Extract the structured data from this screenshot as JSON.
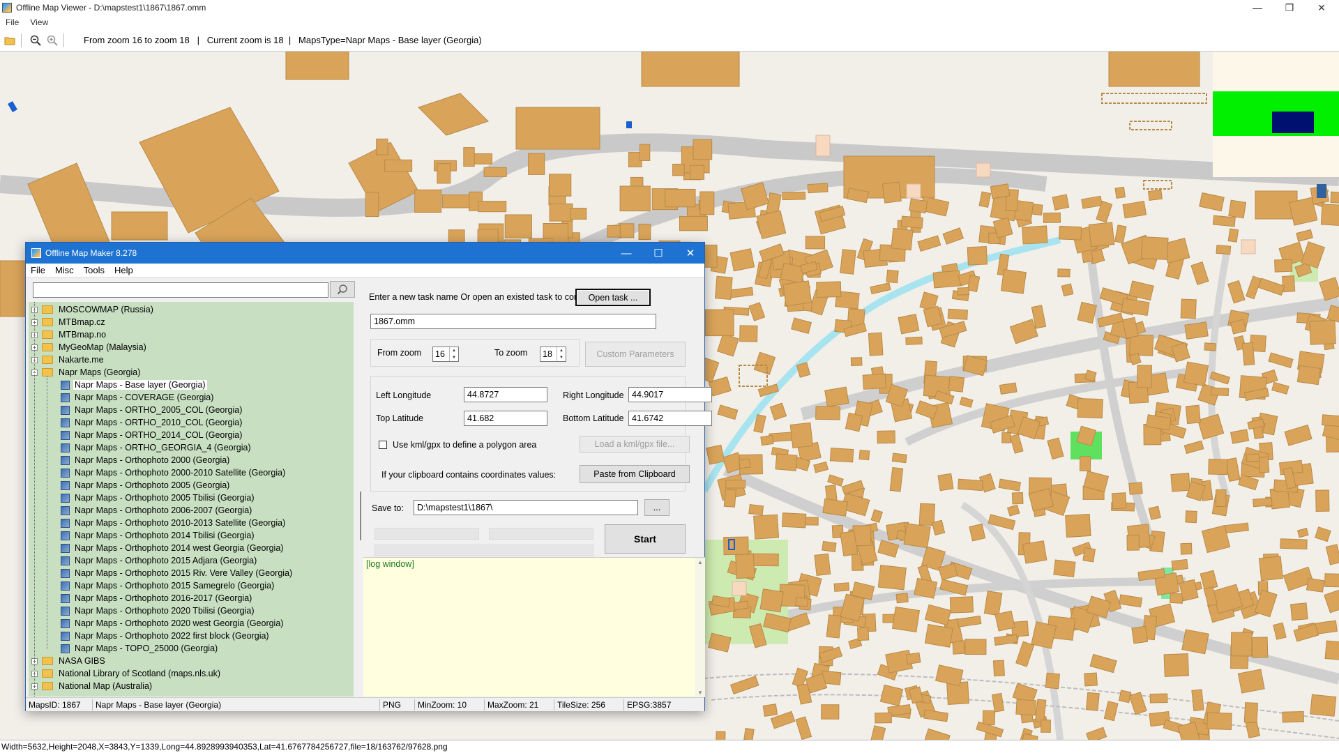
{
  "viewer": {
    "title": "Offline Map Viewer - D:\\mapstest1\\1867\\1867.omm",
    "menu": [
      "File",
      "View"
    ],
    "toolbar_info": "From zoom 16 to zoom 18   |   Current zoom is 18  |   MapsType=Napr Maps - Base layer (Georgia)",
    "statusbar": "Width=5632,Height=2048,X=3843,Y=1339,Long=44.8928993940353,Lat=41.6767784256727,file=18/163762/97628.png"
  },
  "dialog": {
    "title": "Offline Map Maker 8.278",
    "menu": [
      "File",
      "Misc",
      "Tools",
      "Help"
    ],
    "search_value": "",
    "tree": [
      {
        "label": "MOSCOWMAP (Russia)",
        "type": "folder",
        "expander": "+"
      },
      {
        "label": "MTBmap.cz",
        "type": "folder",
        "expander": "+"
      },
      {
        "label": "MTBmap.no",
        "type": "folder",
        "expander": "+"
      },
      {
        "label": "MyGeoMap (Malaysia)",
        "type": "folder",
        "expander": "+"
      },
      {
        "label": "Nakarte.me",
        "type": "folder",
        "expander": "+"
      },
      {
        "label": "Napr Maps (Georgia)",
        "type": "folder",
        "expander": "−"
      },
      {
        "label": "Napr Maps - Base layer (Georgia)",
        "type": "map",
        "selected": true
      },
      {
        "label": "Napr Maps - COVERAGE (Georgia)",
        "type": "map"
      },
      {
        "label": "Napr Maps - ORTHO_2005_COL (Georgia)",
        "type": "map"
      },
      {
        "label": "Napr Maps - ORTHO_2010_COL (Georgia)",
        "type": "map"
      },
      {
        "label": "Napr Maps - ORTHO_2014_COL (Georgia)",
        "type": "map"
      },
      {
        "label": "Napr Maps - ORTHO_GEORGIA_4 (Georgia)",
        "type": "map"
      },
      {
        "label": "Napr Maps - Orthophoto 2000 (Georgia)",
        "type": "map"
      },
      {
        "label": "Napr Maps - Orthophoto 2000-2010 Satellite (Georgia)",
        "type": "map"
      },
      {
        "label": "Napr Maps - Orthophoto 2005 (Georgia)",
        "type": "map"
      },
      {
        "label": "Napr Maps - Orthophoto 2005 Tbilisi (Georgia)",
        "type": "map"
      },
      {
        "label": "Napr Maps - Orthophoto 2006-2007 (Georgia)",
        "type": "map"
      },
      {
        "label": "Napr Maps - Orthophoto 2010-2013 Satellite (Georgia)",
        "type": "map"
      },
      {
        "label": "Napr Maps - Orthophoto 2014 Tbilisi (Georgia)",
        "type": "map"
      },
      {
        "label": "Napr Maps - Orthophoto 2014 west Georgia (Georgia)",
        "type": "map"
      },
      {
        "label": "Napr Maps - Orthophoto 2015 Adjara (Georgia)",
        "type": "map"
      },
      {
        "label": "Napr Maps - Orthophoto 2015 Riv. Vere Valley (Georgia)",
        "type": "map"
      },
      {
        "label": "Napr Maps - Orthophoto 2015 Samegrelo (Georgia)",
        "type": "map"
      },
      {
        "label": "Napr Maps - Orthophoto 2016-2017 (Georgia)",
        "type": "map"
      },
      {
        "label": "Napr Maps - Orthophoto 2020 Tbilisi (Georgia)",
        "type": "map"
      },
      {
        "label": "Napr Maps - Orthophoto 2020 west Georgia (Georgia)",
        "type": "map"
      },
      {
        "label": "Napr Maps - Orthophoto 2022 first block (Georgia)",
        "type": "map"
      },
      {
        "label": "Napr Maps - TOPO_25000 (Georgia)",
        "type": "map"
      },
      {
        "label": "NASA GIBS",
        "type": "folder",
        "expander": "+"
      },
      {
        "label": "National Library of Scotland (maps.nls.uk)",
        "type": "folder",
        "expander": "+"
      },
      {
        "label": "National Map (Australia)",
        "type": "folder",
        "expander": "+"
      }
    ],
    "task_prompt": "Enter a new task name Or open an existed task to continue:",
    "open_task_label": "Open task ...",
    "task_name": "1867.omm",
    "from_zoom_label": "From zoom",
    "from_zoom": "16",
    "to_zoom_label": "To zoom",
    "to_zoom": "18",
    "custom_params_label": "Custom Parameters",
    "left_lon_label": "Left Longitude",
    "left_lon": "44.8727",
    "right_lon_label": "Right Longitude",
    "right_lon": "44.9017",
    "top_lat_label": "Top Latitude",
    "top_lat": "41.682",
    "bottom_lat_label": "Bottom Latitude",
    "bottom_lat": "41.6742",
    "kml_label": "Use kml/gpx to define a polygon area",
    "load_kml_label": "Load a kml/gpx file...",
    "clipboard_prompt": "If your clipboard contains coordinates values:",
    "paste_label": "Paste from Clipboard",
    "save_to_label": "Save to:",
    "save_to": "D:\\mapstest1\\1867\\",
    "browse_label": "...",
    "start_label": "Start",
    "log_label": "[log window]",
    "status": {
      "maps_id": "MapsID: 1867",
      "map_name": "Napr Maps - Base layer (Georgia)",
      "format": "PNG",
      "min_zoom": "MinZoom: 10",
      "max_zoom": "MaxZoom: 21",
      "tile_size": "TileSize: 256",
      "epsg": "EPSG:3857"
    }
  }
}
